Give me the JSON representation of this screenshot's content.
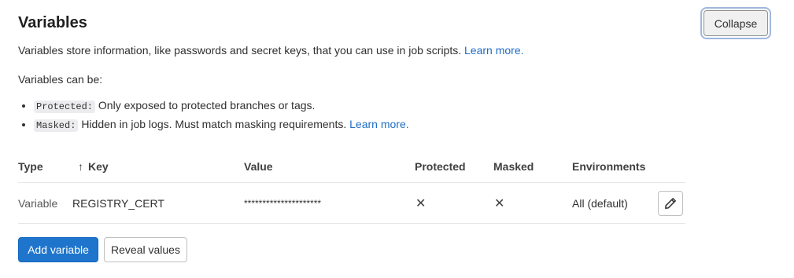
{
  "section": {
    "title": "Variables",
    "collapse_label": "Collapse",
    "description": "Variables store information, like passwords and secret keys, that you can use in job scripts.",
    "learn_more": "Learn more.",
    "can_be": "Variables can be:",
    "bullets": [
      {
        "code": "Protected:",
        "text": "Only exposed to protected branches or tags.",
        "link": ""
      },
      {
        "code": "Masked:",
        "text": "Hidden in job logs. Must match masking requirements.",
        "link": "Learn more."
      }
    ]
  },
  "table": {
    "sort_arrow": "↑",
    "headers": {
      "type": "Type",
      "key": "Key",
      "value": "Value",
      "protected": "Protected",
      "masked": "Masked",
      "environments": "Environments"
    },
    "rows": [
      {
        "type": "Variable",
        "key": "REGISTRY_CERT",
        "value": "*********************",
        "protected": "✕",
        "masked": "✕",
        "environments": "All (default)"
      }
    ]
  },
  "actions": {
    "add_variable": "Add variable",
    "reveal_values": "Reveal values"
  },
  "icons": {
    "edit": "pencil-icon",
    "protected_state": "x-icon",
    "masked_state": "x-icon"
  },
  "colors": {
    "primary": "#1f75cb",
    "link": "#1f6cc4"
  }
}
